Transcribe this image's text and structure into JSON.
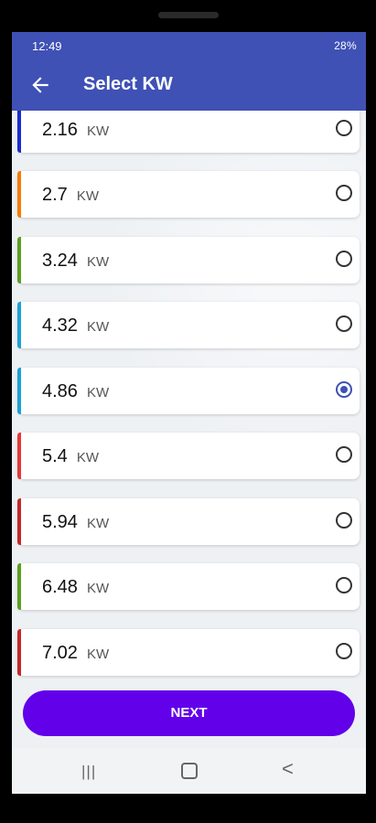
{
  "status": {
    "time": "12:49",
    "right": "28%"
  },
  "header": {
    "title": "Select KW"
  },
  "items": [
    {
      "value": "2.16",
      "unit": "KW",
      "color": "#1a2bd0",
      "selected": false
    },
    {
      "value": "2.7",
      "unit": "KW",
      "color": "#f57c00",
      "selected": false
    },
    {
      "value": "3.24",
      "unit": "KW",
      "color": "#5e9e1f",
      "selected": false
    },
    {
      "value": "4.32",
      "unit": "KW",
      "color": "#1ba1d6",
      "selected": false
    },
    {
      "value": "4.86",
      "unit": "KW",
      "color": "#1ba1d6",
      "selected": true
    },
    {
      "value": "5.4",
      "unit": "KW",
      "color": "#e53935",
      "selected": false
    },
    {
      "value": "5.94",
      "unit": "KW",
      "color": "#c62828",
      "selected": false
    },
    {
      "value": "6.48",
      "unit": "KW",
      "color": "#5e9e1f",
      "selected": false
    },
    {
      "value": "7.02",
      "unit": "KW",
      "color": "#c62828",
      "selected": false
    }
  ],
  "footer": {
    "next_label": "NEXT"
  },
  "nav": {
    "recent_glyph": "|||",
    "back_glyph": "<"
  }
}
